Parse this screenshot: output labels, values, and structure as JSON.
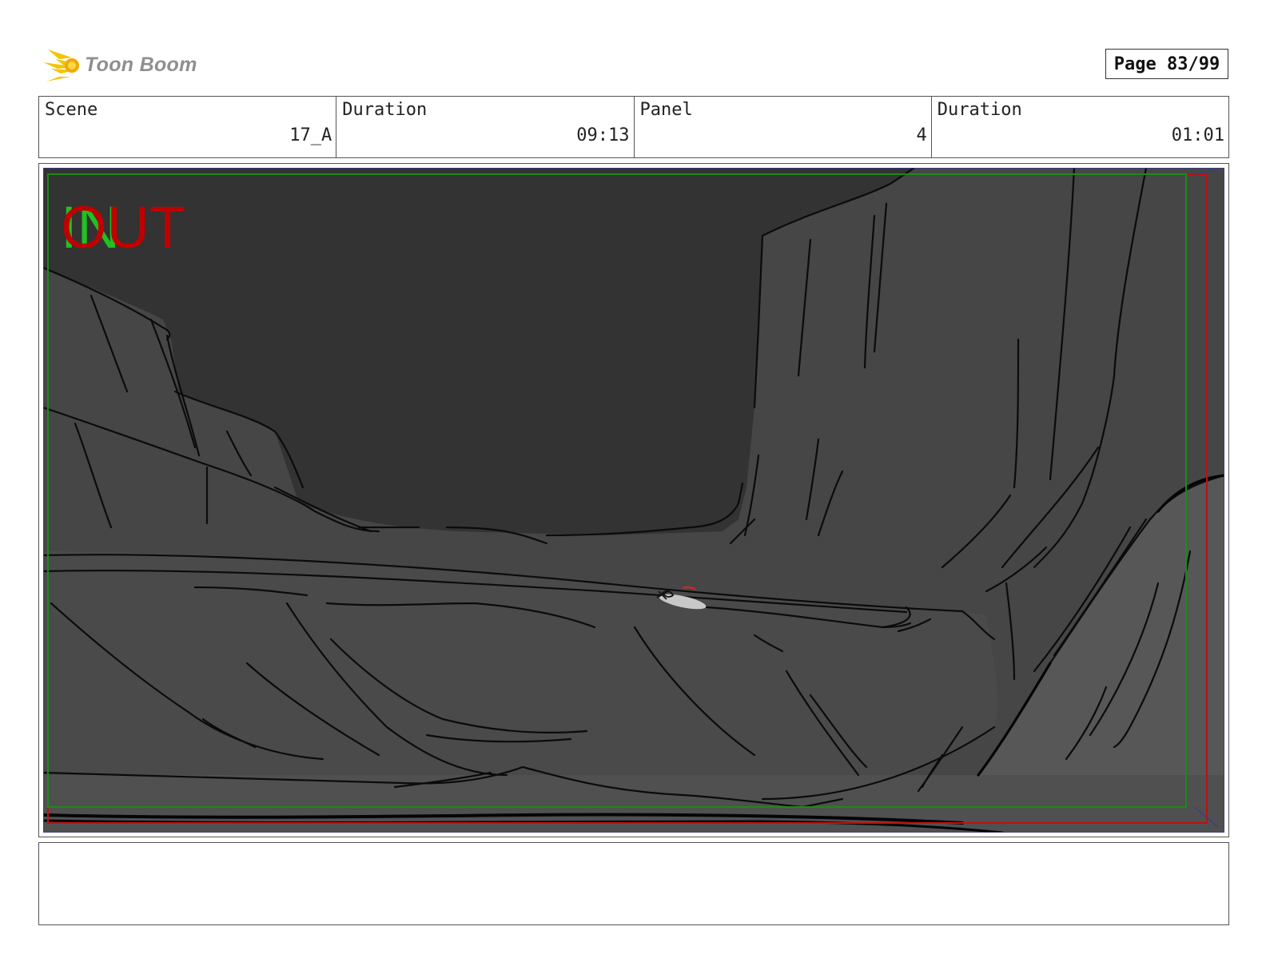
{
  "header": {
    "logo_text": "Toon Boom",
    "page_label": "Page 83/99"
  },
  "info": {
    "scene_label": "Scene",
    "scene_value": "17_A",
    "scene_duration_label": "Duration",
    "scene_duration_value": "09:13",
    "panel_label": "Panel",
    "panel_value": "4",
    "panel_duration_label": "Duration",
    "panel_duration_value": "01:01"
  },
  "frame": {
    "in_label": "IN",
    "out_label": "OUT",
    "colors": {
      "in": "#22c122",
      "out": "#c00000",
      "safe_frame_red": "#c01010",
      "safe_frame_green": "#1a8a1a",
      "sky": "#333333",
      "rock": "#474747",
      "rock_right": "#575757"
    }
  },
  "notes": {
    "text": ""
  }
}
